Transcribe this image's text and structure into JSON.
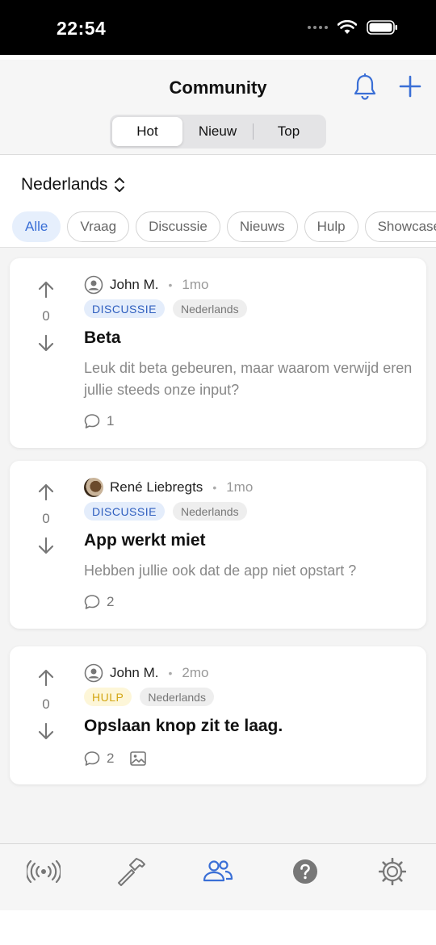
{
  "status_bar": {
    "time": "22:54"
  },
  "header": {
    "title": "Community",
    "segments": [
      "Hot",
      "Nieuw",
      "Top"
    ],
    "active_segment": "Hot"
  },
  "language_selector": {
    "value": "Nederlands"
  },
  "filter_chips": [
    "Alle",
    "Vraag",
    "Discussie",
    "Nieuws",
    "Hulp",
    "Showcase"
  ],
  "posts": [
    {
      "author": "John M.",
      "time": "1mo",
      "category": "DISCUSSIE",
      "language": "Nederlands",
      "title": "Beta",
      "body": "Leuk dit beta gebeuren, maar waarom verwijd eren jullie steeds onze input?",
      "votes": "0",
      "comments": "1"
    },
    {
      "author": "René Liebregts",
      "time": "1mo",
      "category": "DISCUSSIE",
      "language": "Nederlands",
      "title": "App werkt miet",
      "body": "Hebben jullie ook dat de app niet opstart ?",
      "votes": "0",
      "comments": "2"
    },
    {
      "author": "John M.",
      "time": "2mo",
      "category": "HULP",
      "language": "Nederlands",
      "title": "Opslaan knop zit te laag.",
      "votes": "0",
      "comments": "2"
    }
  ],
  "tabbar": {
    "items": [
      "broadcast-icon",
      "hammer-icon",
      "community-icon",
      "help-icon",
      "settings-icon"
    ],
    "active": "community-icon"
  },
  "colors": {
    "accent": "#3a6fd6",
    "hulp": "#d3a614"
  }
}
